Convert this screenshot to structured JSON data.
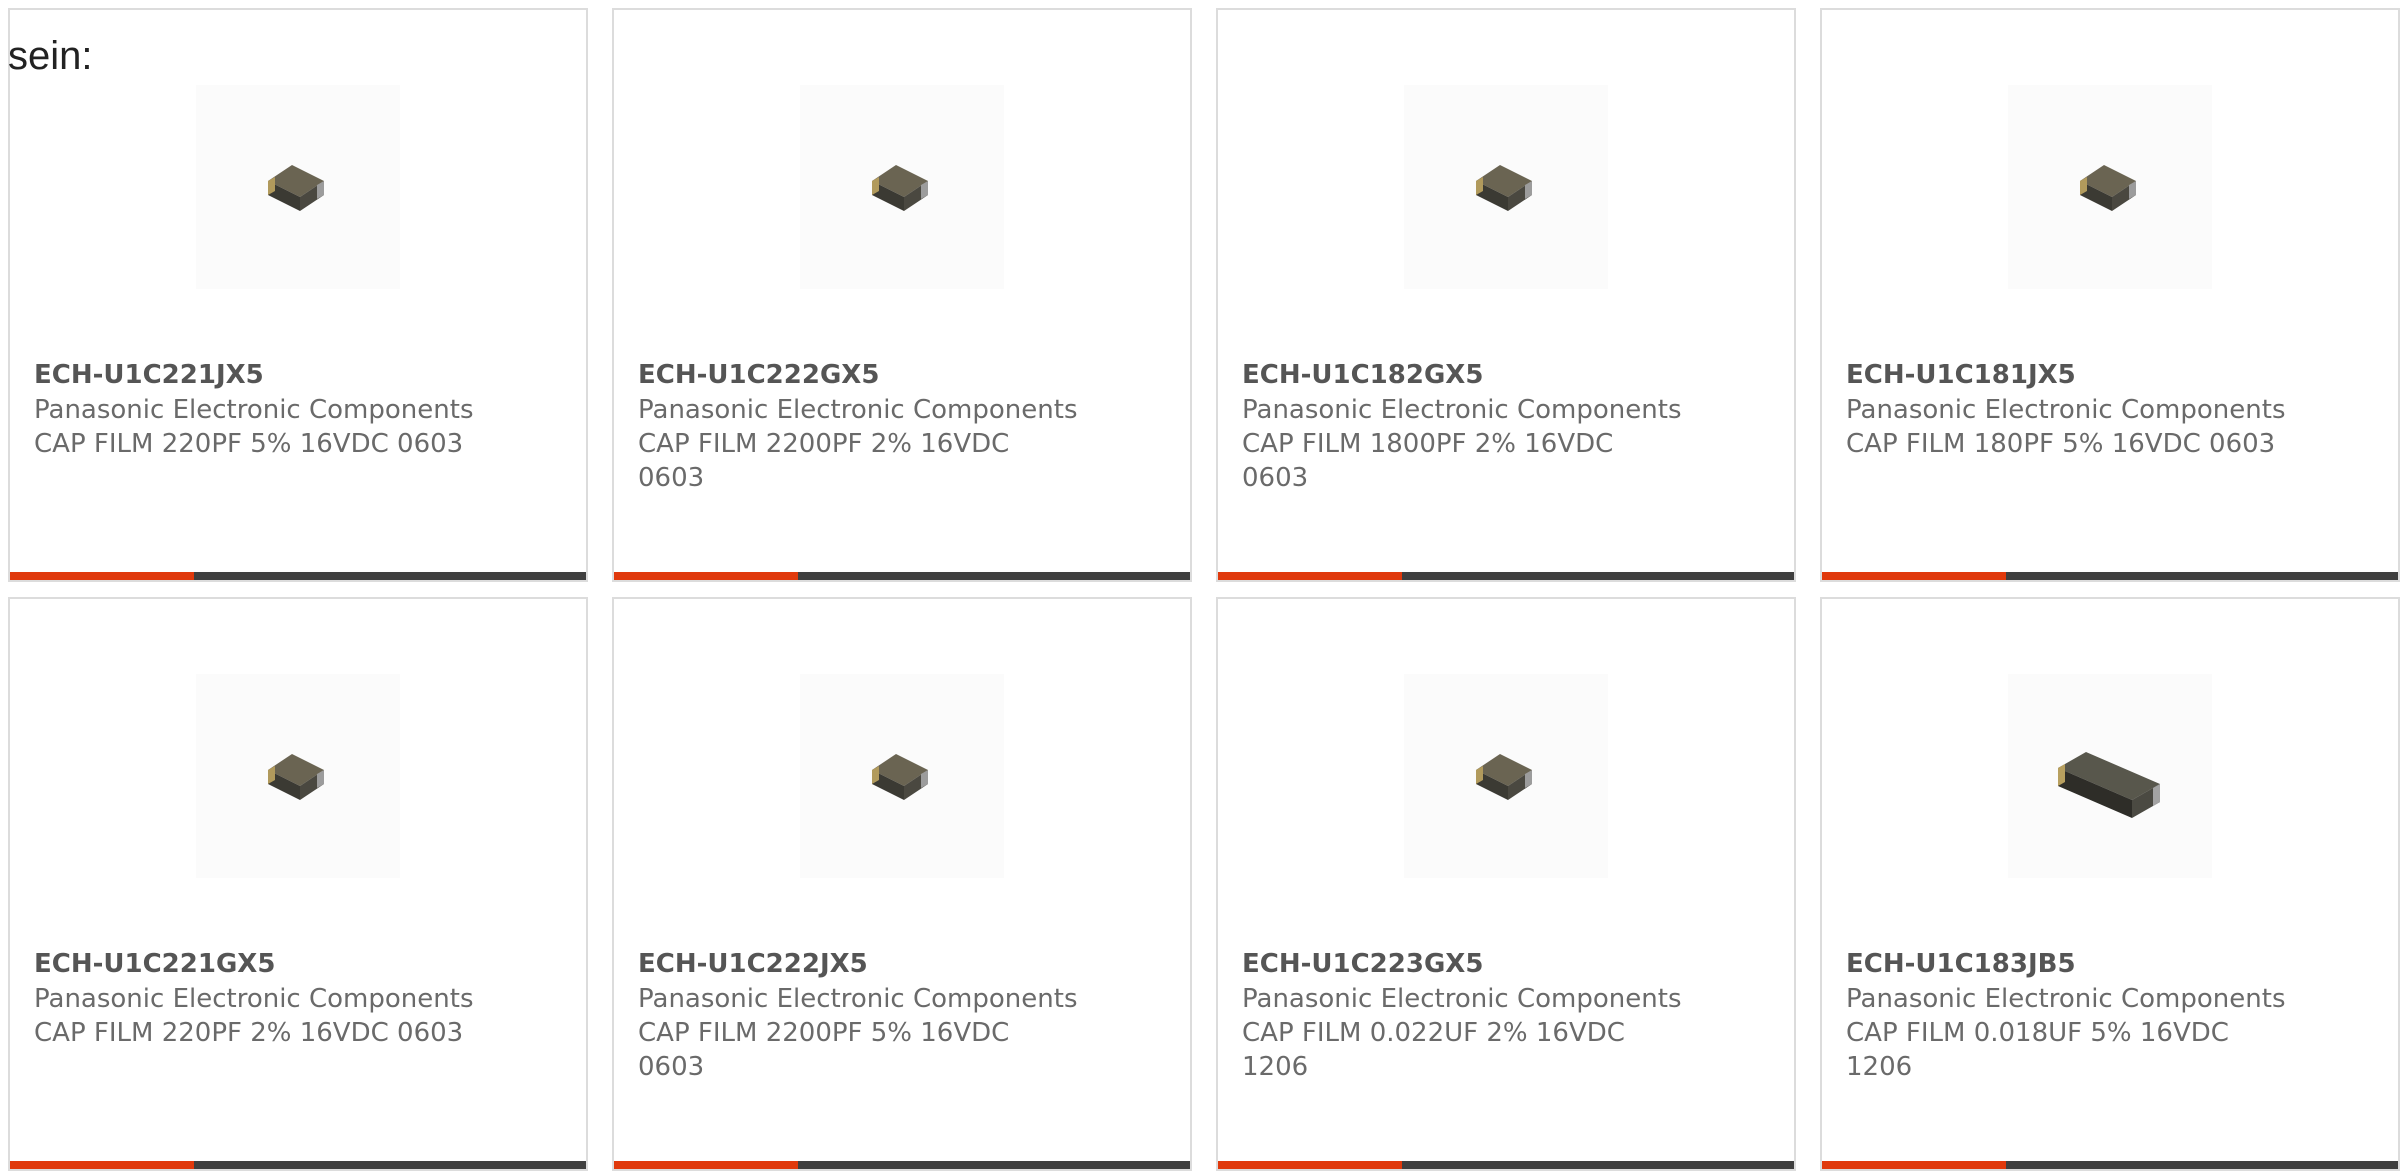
{
  "intro_text": "sein:",
  "accent_color": "#e0390c",
  "bar_color": "#3f3f3f",
  "products": [
    {
      "part_number": "ECH-U1C221JX5",
      "manufacturer": "Panasonic Electronic Components",
      "description": "CAP FILM 220PF 5% 16VDC 0603",
      "image_icon": "capacitor-0603-chip-icon"
    },
    {
      "part_number": "ECH-U1C222GX5",
      "manufacturer": "Panasonic Electronic Components",
      "description": "CAP FILM 2200PF 2% 16VDC 0603",
      "image_icon": "capacitor-0603-chip-icon"
    },
    {
      "part_number": "ECH-U1C182GX5",
      "manufacturer": "Panasonic Electronic Components",
      "description": "CAP FILM 1800PF 2% 16VDC 0603",
      "image_icon": "capacitor-0603-chip-icon"
    },
    {
      "part_number": "ECH-U1C181JX5",
      "manufacturer": "Panasonic Electronic Components",
      "description": "CAP FILM 180PF 5% 16VDC 0603",
      "image_icon": "capacitor-0603-chip-icon"
    },
    {
      "part_number": "ECH-U1C221GX5",
      "manufacturer": "Panasonic Electronic Components",
      "description": "CAP FILM 220PF 2% 16VDC 0603",
      "image_icon": "capacitor-0603-chip-icon"
    },
    {
      "part_number": "ECH-U1C222JX5",
      "manufacturer": "Panasonic Electronic Components",
      "description": "CAP FILM 2200PF 5% 16VDC 0603",
      "image_icon": "capacitor-0603-chip-icon"
    },
    {
      "part_number": "ECH-U1C223GX5",
      "manufacturer": "Panasonic Electronic Components",
      "description": "CAP FILM 0.022UF 2% 16VDC 1206",
      "image_icon": "capacitor-0603-chip-icon"
    },
    {
      "part_number": "ECH-U1C183JB5",
      "manufacturer": "Panasonic Electronic Components",
      "description": "CAP FILM 0.018UF 5% 16VDC 1206",
      "image_icon": "capacitor-1206-chip-icon"
    }
  ]
}
